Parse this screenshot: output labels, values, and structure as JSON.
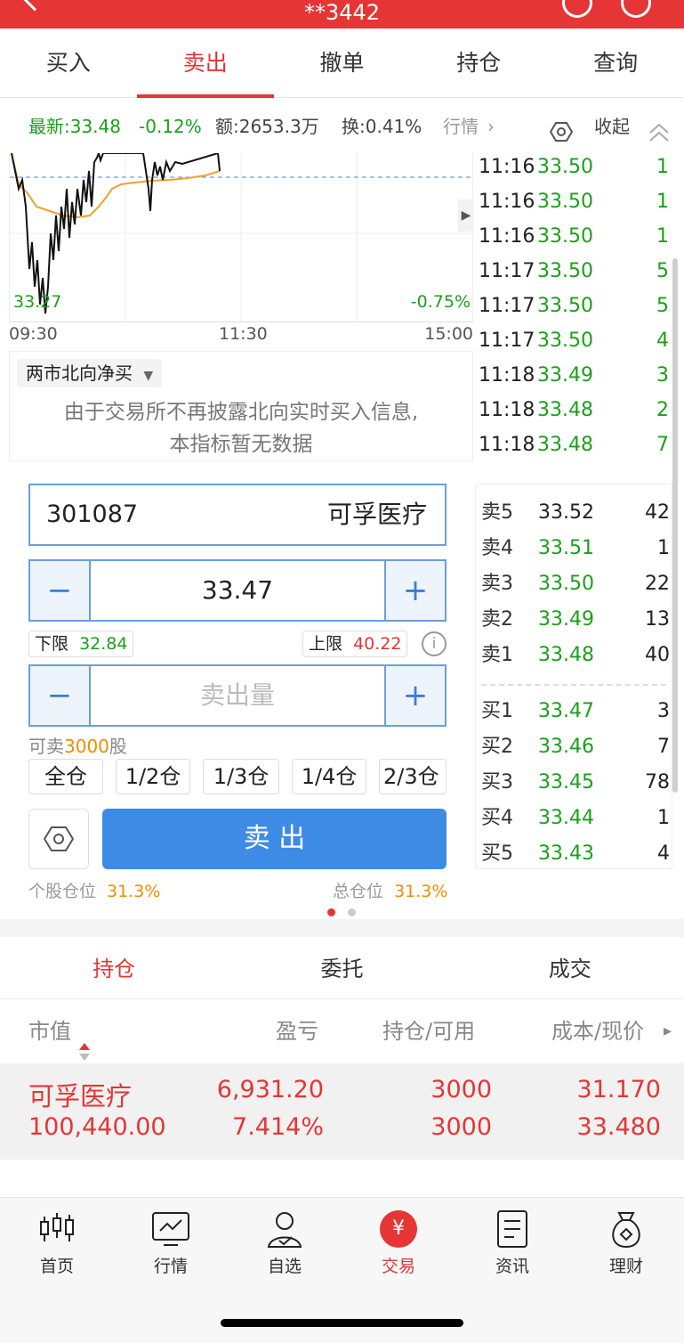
{
  "header": {
    "title": "**3442"
  },
  "tabs": [
    {
      "label": "买入",
      "active": false
    },
    {
      "label": "卖出",
      "active": true
    },
    {
      "label": "撤单",
      "active": false
    },
    {
      "label": "持仓",
      "active": false
    },
    {
      "label": "查询",
      "active": false
    }
  ],
  "info": {
    "latest": "最新:33.48",
    "change": "-0.12%",
    "amount": "额:2653.3万",
    "turnover": "换:0.41%",
    "quote_link": "行情",
    "collapse": "收起"
  },
  "chart": {
    "low_label": "33.27",
    "pct_label": "-0.75%",
    "time_labels": [
      "09:30",
      "11:30",
      "15:00"
    ]
  },
  "north": {
    "dropdown": "两市北向净买",
    "notice_line1": "由于交易所不再披露北向实时买入信息,",
    "notice_line2": "本指标暂无数据"
  },
  "ticks": [
    {
      "time": "11:16",
      "price": "33.50",
      "vol": "1"
    },
    {
      "time": "11:16",
      "price": "33.50",
      "vol": "1"
    },
    {
      "time": "11:16",
      "price": "33.50",
      "vol": "1"
    },
    {
      "time": "11:17",
      "price": "33.50",
      "vol": "5"
    },
    {
      "time": "11:17",
      "price": "33.50",
      "vol": "5"
    },
    {
      "time": "11:17",
      "price": "33.50",
      "vol": "4"
    },
    {
      "time": "11:18",
      "price": "33.49",
      "vol": "3"
    },
    {
      "time": "11:18",
      "price": "33.48",
      "vol": "2"
    },
    {
      "time": "11:18",
      "price": "33.48",
      "vol": "7"
    }
  ],
  "order": {
    "code": "301087",
    "name": "可孚医疗",
    "price": "33.47",
    "lower_label": "下限",
    "lower_value": "32.84",
    "upper_label": "上限",
    "upper_value": "40.22",
    "qty_placeholder": "卖出量",
    "sellable_prefix": "可卖",
    "sellable_qty": "3000",
    "sellable_unit": "股",
    "quick": [
      "全仓",
      "1/2仓",
      "1/3仓",
      "1/4仓",
      "2/3仓"
    ],
    "submit": "卖 出",
    "stock_pos_label": "个股仓位",
    "stock_pos_value": "31.3%",
    "total_pos_label": "总仓位",
    "total_pos_value": "31.3%"
  },
  "book": {
    "asks": [
      {
        "label": "卖5",
        "price": "33.52",
        "vol": "42"
      },
      {
        "label": "卖4",
        "price": "33.51",
        "vol": "1"
      },
      {
        "label": "卖3",
        "price": "33.50",
        "vol": "22"
      },
      {
        "label": "卖2",
        "price": "33.49",
        "vol": "13"
      },
      {
        "label": "卖1",
        "price": "33.48",
        "vol": "40"
      }
    ],
    "bids": [
      {
        "label": "买1",
        "price": "33.47",
        "vol": "3"
      },
      {
        "label": "买2",
        "price": "33.46",
        "vol": "7"
      },
      {
        "label": "买3",
        "price": "33.45",
        "vol": "78"
      },
      {
        "label": "买4",
        "price": "33.44",
        "vol": "1"
      },
      {
        "label": "买5",
        "price": "33.43",
        "vol": "4"
      }
    ]
  },
  "positions_tabs": [
    {
      "label": "持仓",
      "active": true
    },
    {
      "label": "委托",
      "active": false
    },
    {
      "label": "成交",
      "active": false
    }
  ],
  "positions_header": {
    "col1": "市值",
    "col2": "盈亏",
    "col3": "持仓/可用",
    "col4": "成本/现价"
  },
  "positions": [
    {
      "name": "可孚医疗",
      "market_value": "100,440.00",
      "pnl": "6,931.20",
      "pnl_pct": "7.414%",
      "hold": "3000",
      "avail": "3000",
      "cost": "31.170",
      "current": "33.480"
    }
  ],
  "bottom_nav": [
    {
      "label": "首页",
      "icon": "candlestick-icon",
      "active": false
    },
    {
      "label": "行情",
      "icon": "chart-icon",
      "active": false
    },
    {
      "label": "自选",
      "icon": "user-icon",
      "active": false
    },
    {
      "label": "交易",
      "icon": "yen-icon",
      "active": true
    },
    {
      "label": "资讯",
      "icon": "document-icon",
      "active": false
    },
    {
      "label": "理财",
      "icon": "moneybag-icon",
      "active": false
    }
  ],
  "colors": {
    "accent": "#e53535",
    "up": "#1aa01a",
    "primary": "#3a7dd8",
    "position": "#f08c00"
  }
}
